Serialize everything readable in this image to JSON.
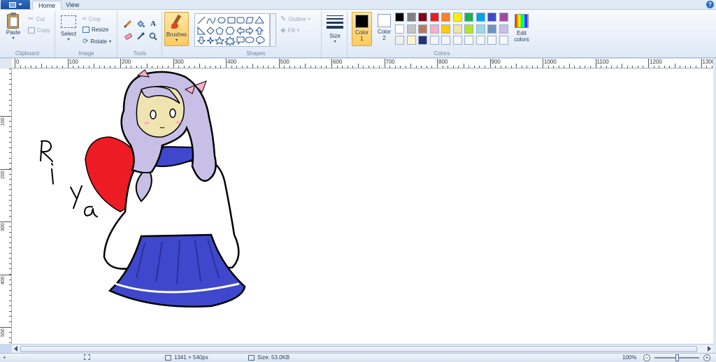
{
  "tabs": {
    "home": "Home",
    "view": "View"
  },
  "clipboard": {
    "paste": "Paste",
    "cut": "Cut",
    "copy": "Copy",
    "label": "Clipboard"
  },
  "image": {
    "select": "Select",
    "crop": "Crop",
    "resize": "Resize",
    "rotate": "Rotate",
    "label": "Image"
  },
  "tools": {
    "label": "Tools",
    "text_glyph": "A"
  },
  "brushes": {
    "label": "Brushes"
  },
  "shapes": {
    "label": "Shapes",
    "outline": "Outline",
    "fill": "Fill"
  },
  "size": {
    "label": "Size"
  },
  "colors": {
    "label": "Colors",
    "color1_line1": "Color",
    "color1_line2": "1",
    "color2_line1": "Color",
    "color2_line2": "2",
    "color1_value": "#000000",
    "color2_value": "#ffffff",
    "edit_line1": "Edit",
    "edit_line2": "colors",
    "palette": [
      [
        "#000000",
        "#7f7f7f",
        "#880015",
        "#ed1c24",
        "#ff7f27",
        "#fff200",
        "#22b14c",
        "#00a2e8",
        "#3f48cc",
        "#a349a4"
      ],
      [
        "#ffffff",
        "#c3c3c3",
        "#b97a57",
        "#ffaec9",
        "#ffc90e",
        "#efe4b0",
        "#b5e61d",
        "#99d9ea",
        "#7092be",
        "#c8bfe7"
      ],
      [
        "#f0f0f0",
        "#fff5cc",
        "#2b2f7a",
        "#f4f7fb",
        "#f4f7fb",
        "#f4f7fb",
        "#f4f7fb",
        "#f4f7fb",
        "#f4f7fb",
        "#f4f7fb"
      ]
    ]
  },
  "ruler": {
    "h_labels": [
      "0",
      "100",
      "200",
      "300",
      "400",
      "500",
      "600",
      "700",
      "800",
      "900",
      "1000",
      "1100",
      "1200",
      "1300"
    ],
    "v_labels": [
      "100",
      "200",
      "300",
      "400",
      "500"
    ]
  },
  "canvas": {
    "signature": "Riya"
  },
  "status": {
    "dimensions": "1341 × 540px",
    "size": "Size: 53.0KB",
    "zoom": "100%"
  }
}
